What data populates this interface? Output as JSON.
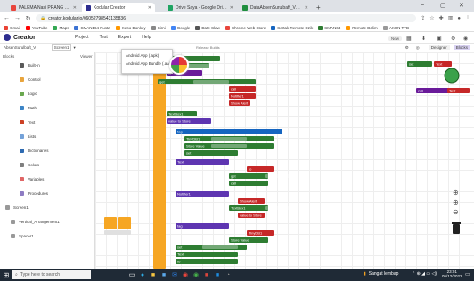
{
  "browser": {
    "tabs": [
      {
        "label": "PALEMA Nasi PRANG PULi",
        "color": "#e8453c",
        "active": false
      },
      {
        "label": "Kodular Creator",
        "color": "#2d2d8f",
        "active": true
      },
      {
        "label": "Drive Saya - Google Drive",
        "color": "#1fa463",
        "active": false
      },
      {
        "label": "DataAbsenSurulbaft_V2 - Goog",
        "color": "#1f8e3e",
        "active": false
      }
    ],
    "new_tab": "+",
    "url": "creator.kodular.io/#6052798543135836",
    "bookmarks": [
      {
        "label": "Gmail",
        "color": "#ea4335"
      },
      {
        "label": "YouTube",
        "color": "#ff0000"
      },
      {
        "label": "Maps",
        "color": "#34a853"
      },
      {
        "label": "SMAN164 Pusta",
        "color": "#3c73d3"
      },
      {
        "label": "Kebo Donkey",
        "color": "#ff9800"
      },
      {
        "label": "Sirni",
        "color": "#888888"
      },
      {
        "label": "Google",
        "color": "#4285f4"
      },
      {
        "label": "Date Slaw",
        "color": "#555555"
      },
      {
        "label": "Chrome Web Store",
        "color": "#e8453c"
      },
      {
        "label": "Sertak Remote Dzik",
        "color": "#1565c0"
      },
      {
        "label": "SMAN64",
        "color": "#2e7d32"
      },
      {
        "label": "Remote Dalim",
        "color": "#ff9800"
      },
      {
        "label": "AKUN TTB",
        "color": "#999999"
      }
    ]
  },
  "app": {
    "logo": "Creator",
    "menus": [
      "Project",
      "Test",
      "Export",
      "Help"
    ],
    "project_name": "AbsenSurulbaft_V2Hw",
    "screen_select": "Screen1",
    "left_section": "Blocks",
    "viewer_label": "Viewer",
    "designer_button": "Designer",
    "blocks_button": "Blocks",
    "dropdown_items": [
      "Android App (.apk)",
      "Android App Bundle (.aab)"
    ],
    "dropdown_extra": "Release Builds"
  },
  "blocks_list": [
    {
      "label": "Built-in",
      "color": "#5a5a5a"
    },
    {
      "label": "Control",
      "color": "#e9a53d"
    },
    {
      "label": "Logic",
      "color": "#6aa84f"
    },
    {
      "label": "Math",
      "color": "#3d85c6"
    },
    {
      "label": "Text",
      "color": "#cc4125"
    },
    {
      "label": "Lists",
      "color": "#75a2d9"
    },
    {
      "label": "Dictionaries",
      "color": "#2d6ab1"
    },
    {
      "label": "Colors",
      "color": "#7f7f7f"
    },
    {
      "label": "Variables",
      "color": "#e06666"
    },
    {
      "label": "Procedures",
      "color": "#8e7cc3"
    },
    {
      "label": "Screen1",
      "color": "#999999"
    },
    {
      "label": "Vertical_Arrangement1",
      "color": "#999999"
    },
    {
      "label": "Spacer1",
      "color": "#999999"
    }
  ],
  "workspace": {
    "chip_texts": [
      "set",
      "Text",
      "to",
      "get",
      "call",
      "Notifier1",
      "Show Alert",
      "TextBox1",
      "value to Store",
      "tag",
      "TinyDB1",
      "Store Value"
    ],
    "side_labels": [
      "set",
      "Text",
      "call",
      "Text"
    ]
  },
  "taskbar": {
    "search_placeholder": "Type here to search",
    "weather": "Sangat lembap",
    "time": "23:01",
    "date": "05/12/2022"
  }
}
